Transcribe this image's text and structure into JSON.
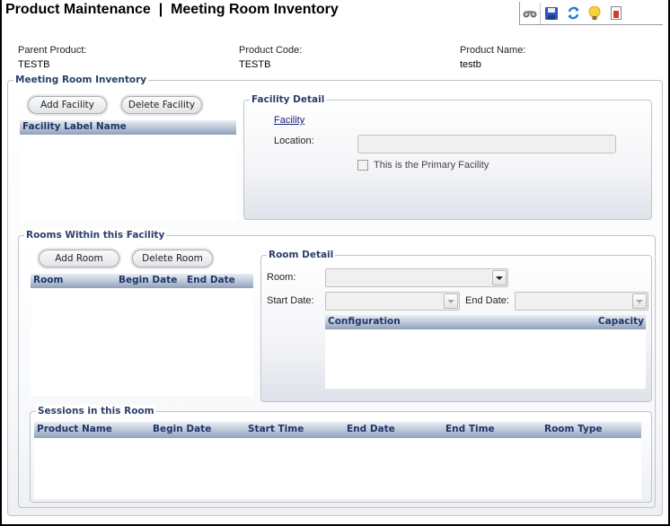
{
  "header": {
    "title": "Product Maintenance  |  Meeting Room Inventory",
    "toolbar": [
      {
        "icon": "binoculars-icon",
        "label": "Find"
      },
      {
        "icon": "save-icon",
        "label": "Save"
      },
      {
        "icon": "refresh-icon",
        "label": "Refresh"
      },
      {
        "icon": "lightbulb-icon",
        "label": "Help"
      },
      {
        "icon": "report-icon",
        "label": "Report"
      }
    ]
  },
  "product_info": {
    "parent_product_label": "Parent Product:",
    "parent_product_value": "TESTB",
    "product_code_label": "Product Code:",
    "product_code_value": "TESTB",
    "product_name_label": "Product Name:",
    "product_name_value": "testb"
  },
  "meeting_room_inventory": {
    "legend": "Meeting Room Inventory",
    "add_facility": "Add Facility",
    "delete_facility": "Delete Facility",
    "facility_grid": {
      "columns": [
        "Facility Label Name"
      ],
      "rows": []
    },
    "facility_detail": {
      "legend": "Facility Detail",
      "facility_link": "Facility",
      "location_label": "Location:",
      "location_value": "",
      "primary_checkbox_label": "This is the Primary Facility",
      "primary_checked": false
    }
  },
  "rooms": {
    "legend": "Rooms Within this Facility",
    "add_room": "Add Room",
    "delete_room": "Delete Room",
    "room_grid": {
      "columns": [
        "Room",
        "Begin Date",
        "End Date"
      ],
      "rows": []
    },
    "room_detail": {
      "legend": "Room Detail",
      "room_label": "Room:",
      "room_value": "",
      "start_date_label": "Start Date:",
      "start_date_value": "",
      "end_date_label": "End Date:",
      "end_date_value": "",
      "config_grid": {
        "columns": [
          "Configuration",
          "Capacity"
        ],
        "rows": []
      }
    },
    "sessions": {
      "legend": "Sessions in this Room",
      "columns": [
        "Product Name",
        "Begin Date",
        "Start Time",
        "End Date",
        "End Time",
        "Room Type"
      ],
      "rows": []
    }
  }
}
